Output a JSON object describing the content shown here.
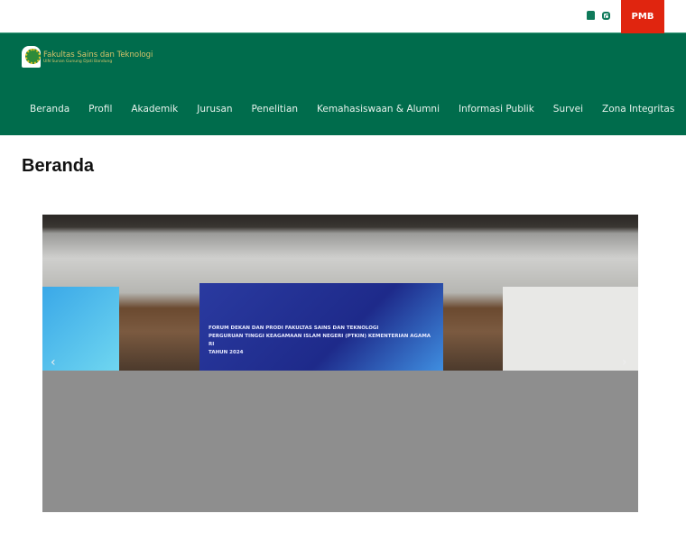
{
  "topbar": {
    "pmb_label": "PMB",
    "social": [
      "youtube-icon",
      "instagram-icon"
    ]
  },
  "logo": {
    "title": "Fakultas Sains dan Teknologi",
    "subtitle": "UIN Sunan Gunung Djati Bandung"
  },
  "nav": [
    "Beranda",
    "Profil",
    "Akademik",
    "Jurusan",
    "Penelitian",
    "Kemahasiswaan & Alumni",
    "Informasi Publik",
    "Survei",
    "Zona Integritas"
  ],
  "page": {
    "title": "Beranda"
  },
  "slider": {
    "banner_lines": [
      "FORUM DEKAN DAN PRODI FAKULTAS SAINS DAN TEKNOLOGI",
      "PERGURUAN TINGGI KEAGAMAAN ISLAM NEGERI (PTKIN) KEMENTERIAN AGAMA RI",
      "TAHUN 2024"
    ],
    "prev": "‹",
    "next": "›"
  },
  "colors": {
    "header": "#006c4c",
    "pmb": "#e0250f"
  }
}
